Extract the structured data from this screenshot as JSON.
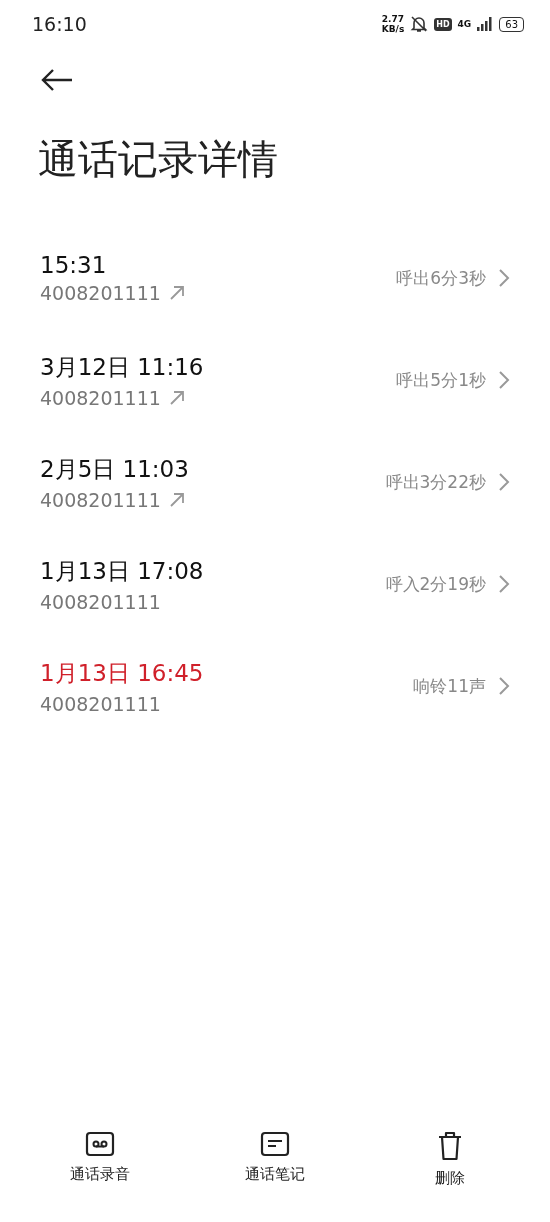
{
  "status_bar": {
    "time": "16:10",
    "net_speed": [
      "2.77",
      "KB/s"
    ],
    "hd": "HD",
    "network": "4G",
    "battery": "63"
  },
  "title": "通话记录详情",
  "calls": [
    {
      "time": "15:31",
      "number": "4008201111",
      "kind": "outgoing",
      "summary": "呼出6分3秒"
    },
    {
      "time": "3月12日 11:16",
      "number": "4008201111",
      "kind": "outgoing",
      "summary": "呼出5分1秒"
    },
    {
      "time": "2月5日 11:03",
      "number": "4008201111",
      "kind": "outgoing",
      "summary": "呼出3分22秒"
    },
    {
      "time": "1月13日 17:08",
      "number": "4008201111",
      "kind": "incoming",
      "summary": "呼入2分19秒"
    },
    {
      "time": "1月13日 16:45",
      "number": "4008201111",
      "kind": "missed",
      "summary": "响铃11声"
    }
  ],
  "actions": [
    {
      "kind": "recording",
      "label": "通话录音"
    },
    {
      "kind": "notes",
      "label": "通话笔记"
    },
    {
      "kind": "delete",
      "label": "删除"
    }
  ]
}
